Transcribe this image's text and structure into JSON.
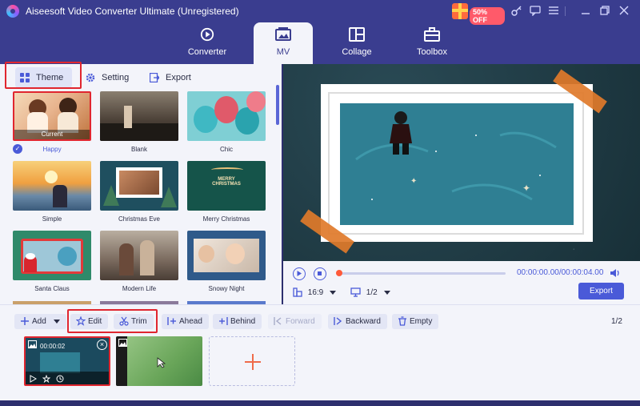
{
  "window": {
    "title": "Aiseesoft Video Converter Ultimate (Unregistered)",
    "promo_badge": "50% OFF",
    "controls": [
      "gift-icon",
      "key-icon",
      "chat-icon",
      "menu-icon",
      "minimize-icon",
      "restore-icon",
      "close-icon"
    ]
  },
  "modules": [
    {
      "label": "Converter",
      "icon": "converter-icon"
    },
    {
      "label": "MV",
      "icon": "mv-icon"
    },
    {
      "label": "Collage",
      "icon": "collage-icon"
    },
    {
      "label": "Toolbox",
      "icon": "toolbox-icon"
    }
  ],
  "active_module": "MV",
  "subtabs": [
    {
      "label": "Theme",
      "icon": "grid-icon"
    },
    {
      "label": "Setting",
      "icon": "gear-icon"
    },
    {
      "label": "Export",
      "icon": "export-icon"
    }
  ],
  "themes": [
    {
      "label": "Happy",
      "current_tag": "Current",
      "selected": true
    },
    {
      "label": "Blank"
    },
    {
      "label": "Chic"
    },
    {
      "label": "Simple"
    },
    {
      "label": "Christmas Eve",
      "overlay_text": ""
    },
    {
      "label": "Merry Christmas",
      "overlay_text": "MERRY CHRISTMAS"
    },
    {
      "label": "Santa Claus"
    },
    {
      "label": "Modern Life"
    },
    {
      "label": "Snowy Night"
    }
  ],
  "player": {
    "time": "00:00:00.00/00:00:04.00",
    "aspect_ratio": "16:9",
    "screen_split": "1/2",
    "export_label": "Export",
    "progress": 0.0
  },
  "toolbar": {
    "add": "Add",
    "edit": "Edit",
    "trim": "Trim",
    "ahead": "Ahead",
    "behind": "Behind",
    "forward": "Forward",
    "backward": "Backward",
    "empty": "Empty",
    "page": "1/2"
  },
  "clips": [
    {
      "duration": "00:00:02",
      "selected": true
    },
    {
      "duration": ""
    }
  ],
  "colors": {
    "accent": "#4a5ad8",
    "highlight_red": "#e0262f",
    "title_bar": "#3a3d8f",
    "panel_bg": "#f3f4fa"
  }
}
